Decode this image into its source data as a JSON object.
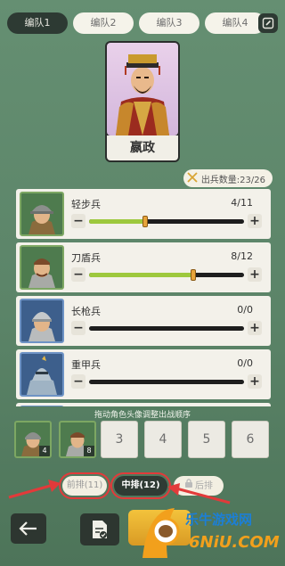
{
  "tabs": [
    {
      "label": "编队1",
      "active": true
    },
    {
      "label": "编队2",
      "active": false
    },
    {
      "label": "编队3",
      "active": false
    },
    {
      "label": "编队4",
      "active": false
    }
  ],
  "edit_icon": "edit-icon",
  "hero": {
    "name": "嬴政"
  },
  "troop_count": {
    "label": "出兵数量:23/26"
  },
  "units": [
    {
      "name": "轻步兵",
      "amount": "4/11",
      "fill_fraction": 0.36,
      "avatar_color": "green"
    },
    {
      "name": "刀盾兵",
      "amount": "8/12",
      "fill_fraction": 0.67,
      "avatar_color": "green"
    },
    {
      "name": "长枪兵",
      "amount": "0/0",
      "fill_fraction": 0,
      "avatar_color": "blue"
    },
    {
      "name": "重甲兵",
      "amount": "0/0",
      "fill_fraction": 0,
      "avatar_color": "blue"
    }
  ],
  "drag_hint": "拖动角色头像调整出战顺序",
  "slots": [
    {
      "type": "filled",
      "badge": "4"
    },
    {
      "type": "filled",
      "badge": "8"
    },
    {
      "type": "empty",
      "label": "3"
    },
    {
      "type": "empty",
      "label": "4"
    },
    {
      "type": "empty",
      "label": "5"
    },
    {
      "type": "empty",
      "label": "6"
    }
  ],
  "rows": {
    "front": "前排(11)",
    "middle": "中排(12)",
    "back": "后排"
  },
  "watermark": {
    "brand": "乐牛游戏网",
    "domain": "6NiU.COM"
  },
  "colors": {
    "background": "#5f8a6c",
    "accent_green": "#9dc83d",
    "slider_thumb": "#e7a43b",
    "highlight_red": "#e23a3a"
  }
}
